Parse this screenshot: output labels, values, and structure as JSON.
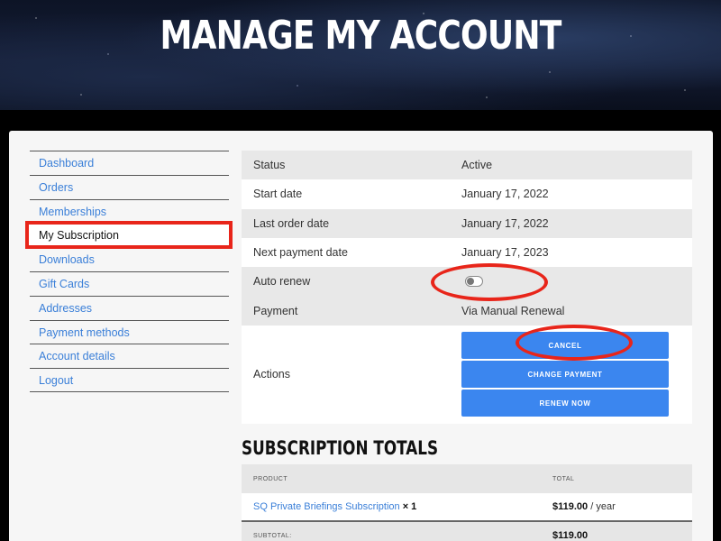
{
  "page": {
    "title": "MANAGE MY ACCOUNT"
  },
  "sidebar": {
    "items": [
      {
        "label": "Dashboard"
      },
      {
        "label": "Orders"
      },
      {
        "label": "Memberships"
      },
      {
        "label": "My Subscription",
        "active": true
      },
      {
        "label": "Downloads"
      },
      {
        "label": "Gift Cards"
      },
      {
        "label": "Addresses"
      },
      {
        "label": "Payment methods"
      },
      {
        "label": "Account details"
      },
      {
        "label": "Logout"
      }
    ]
  },
  "subscription": {
    "rows": [
      {
        "label": "Status",
        "value": "Active"
      },
      {
        "label": "Start date",
        "value": "January 17, 2022"
      },
      {
        "label": "Last order date",
        "value": "January 17, 2022"
      },
      {
        "label": "Next payment date",
        "value": "January 17, 2023"
      },
      {
        "label": "Auto renew",
        "value": ""
      },
      {
        "label": "Payment",
        "value": "Via Manual Renewal"
      }
    ],
    "auto_renew_enabled": false,
    "actions_label": "Actions",
    "buttons": {
      "cancel": "CANCEL",
      "change_payment": "CHANGE PAYMENT",
      "renew_now": "RENEW NOW"
    }
  },
  "totals": {
    "title": "SUBSCRIPTION TOTALS",
    "headers": {
      "product": "PRODUCT",
      "total": "TOTAL"
    },
    "item": {
      "name": "SQ Private Briefings Subscription",
      "qty": "× 1",
      "price": "$119.00",
      "period": "/ year"
    },
    "subtotal": {
      "label": "SUBTOTAL:",
      "value": "$119.00"
    }
  },
  "colors": {
    "accent": "#3b86ef",
    "link": "#3a7fd8",
    "annotation": "#e8251a"
  }
}
